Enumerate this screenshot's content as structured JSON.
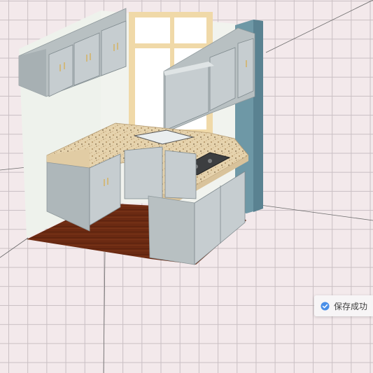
{
  "toast": {
    "message": "保存成功",
    "icon": "check-circle-icon",
    "icon_color": "#4a8fe8"
  },
  "colors": {
    "canvas_background": "#f3e9eb",
    "grid_line": "#c9bfc3",
    "cabinet": "#b8c0c2",
    "countertop": "#e6d2ac",
    "floor": "#6b2a12",
    "accent_wall": "#6e98a6",
    "window_frame": "#f0d9a8"
  }
}
